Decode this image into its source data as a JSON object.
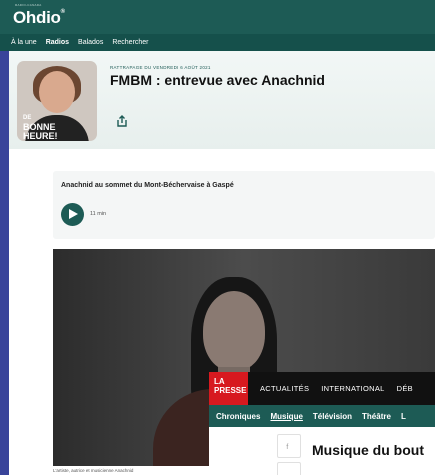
{
  "ohdio": {
    "tagline": "RADIO-CANADA",
    "logo": "Ohdio",
    "nav": [
      "À la une",
      "Radios",
      "Balados",
      "Rechercher"
    ],
    "episode": {
      "eyebrow": "RATTRAPAGE DU VENDREDI 6 AOÛT 2021",
      "title": "FMBM :  entrevue avec Anachnid",
      "thumb_line1": "DE",
      "thumb_line2": "BONNE HEURE!"
    },
    "clip": {
      "title": "Anachnid au sommet du Mont-Béchervaise à Gaspé",
      "duration": "11 min"
    },
    "caption": "L'artiste, autrice et musicienne Anachnid"
  },
  "lapresse": {
    "logo": "LA PRESSE",
    "tabs": [
      "ACTUALITÉS",
      "INTERNATIONAL",
      "DÉB"
    ],
    "sub": [
      "Chroniques",
      "Musique",
      "Télévision",
      "Théâtre",
      "L"
    ],
    "headline": "Musique du bout"
  },
  "colors": {
    "brand_green": "#1d5b55",
    "lapresse_red": "#d7191f"
  }
}
